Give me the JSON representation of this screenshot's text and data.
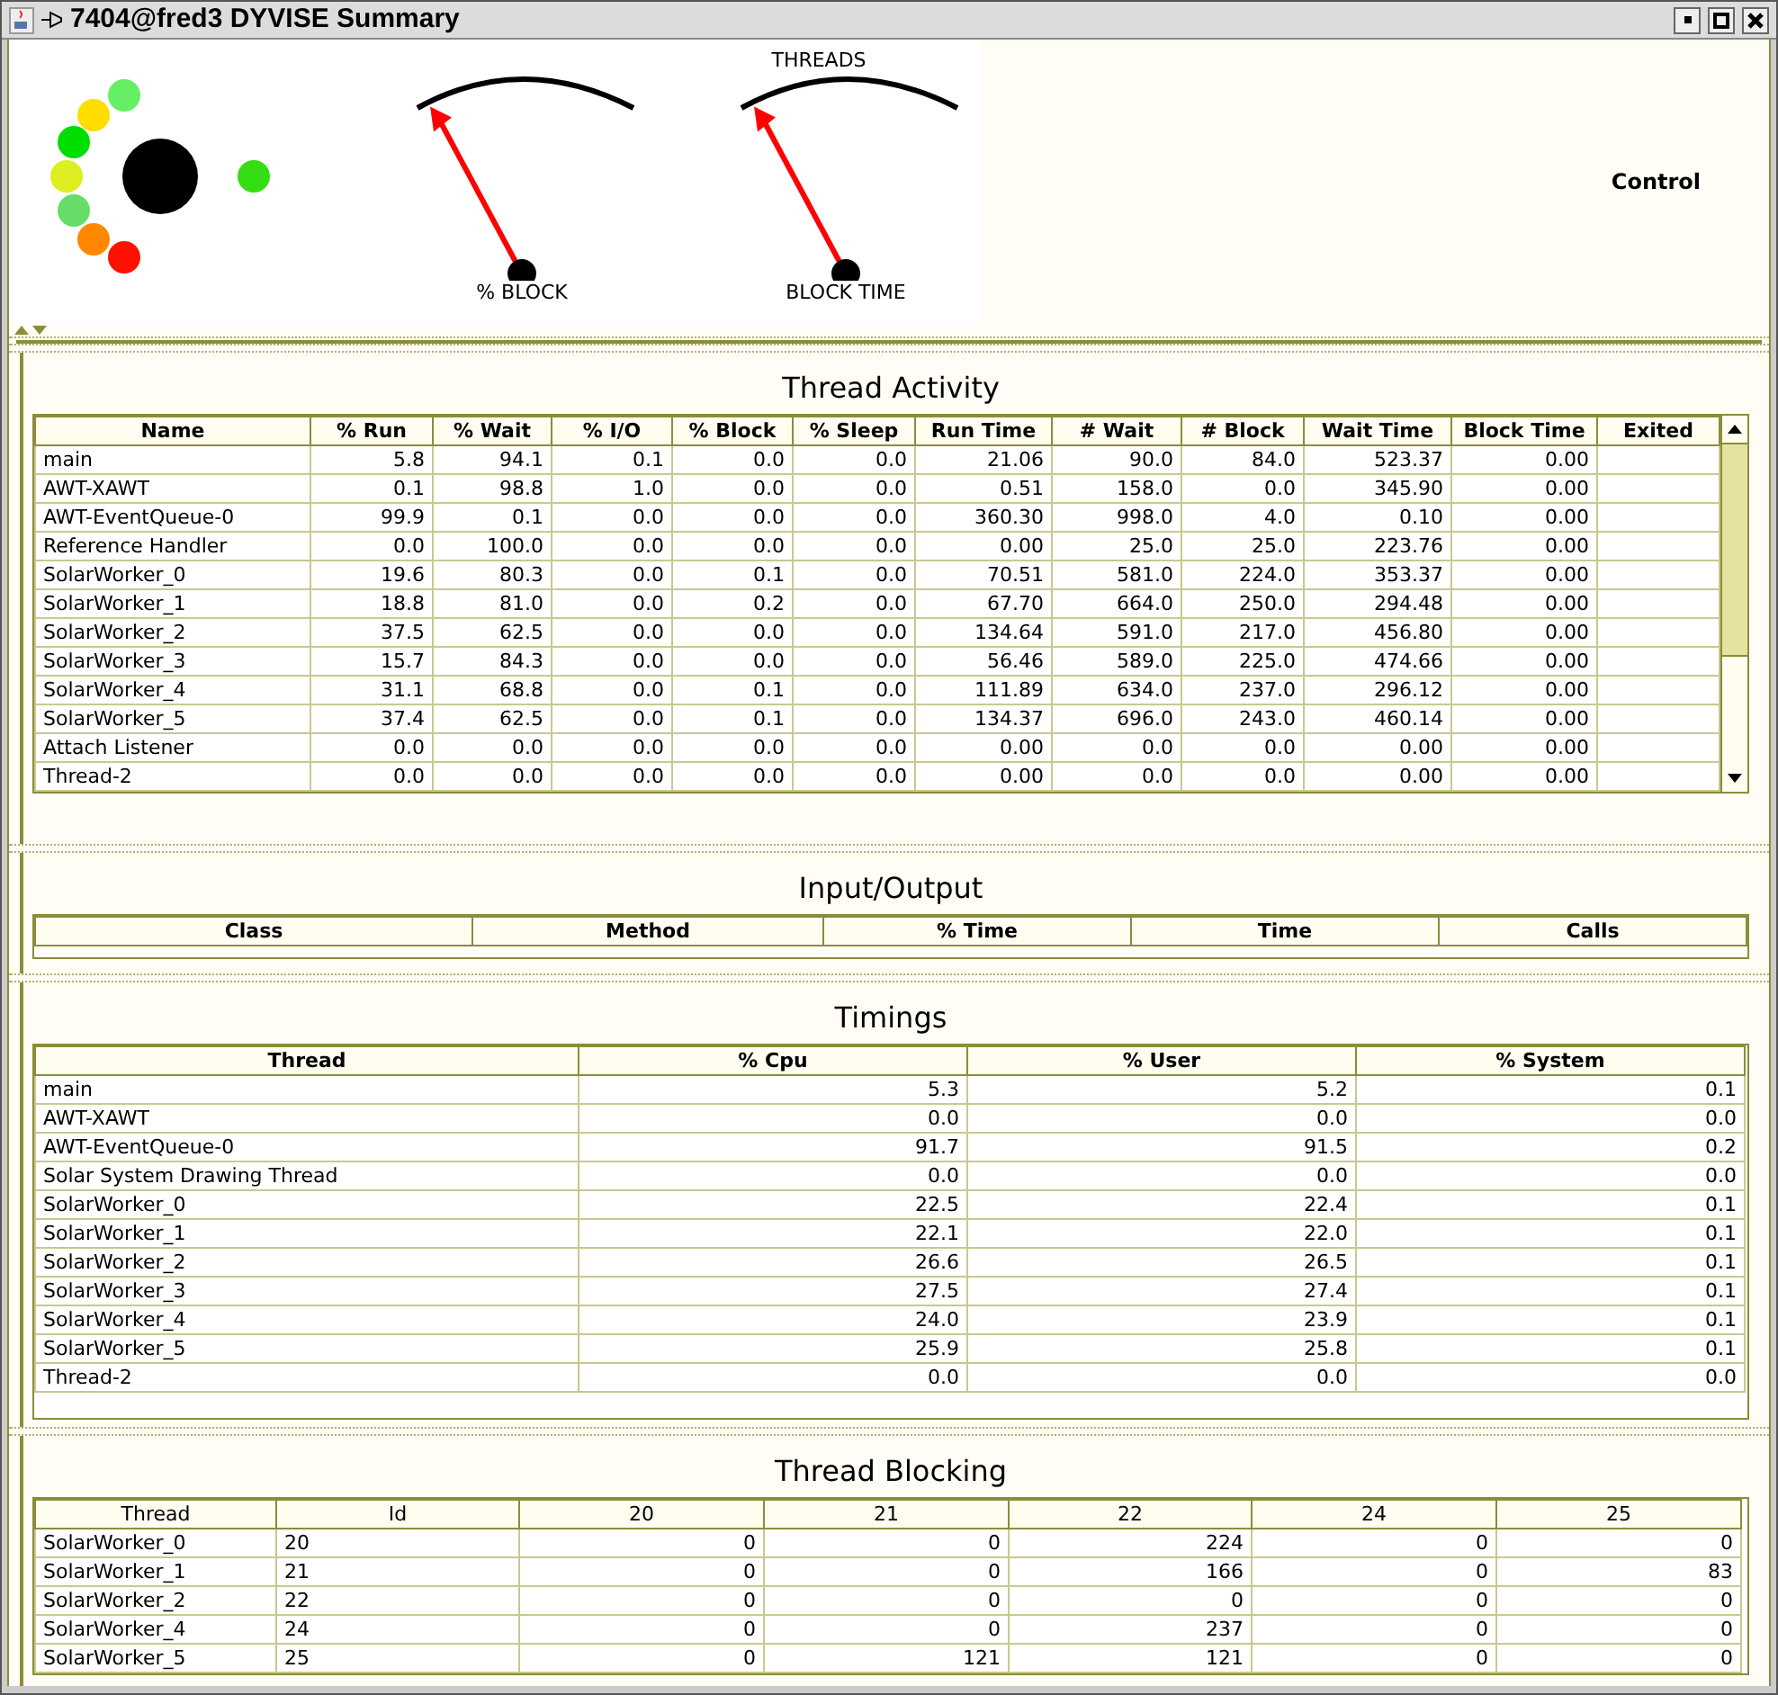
{
  "window": {
    "title": "7404@fred3 DYVISE Summary"
  },
  "top_panel": {
    "gauges_title": "THREADS",
    "gauges": [
      {
        "label": "% BLOCK"
      },
      {
        "label": "BLOCK TIME"
      }
    ],
    "control_label": "Control"
  },
  "thread_activity": {
    "title": "Thread Activity",
    "columns": [
      "Name",
      "% Run",
      "% Wait",
      "% I/O",
      "% Block",
      "% Sleep",
      "Run Time",
      "# Wait",
      "# Block",
      "Wait Time",
      "Block Time",
      "Exited"
    ],
    "rows": [
      [
        "main",
        "5.8",
        "94.1",
        "0.1",
        "0.0",
        "0.0",
        "21.06",
        "90.0",
        "84.0",
        "523.37",
        "0.00"
      ],
      [
        "AWT-XAWT",
        "0.1",
        "98.8",
        "1.0",
        "0.0",
        "0.0",
        "0.51",
        "158.0",
        "0.0",
        "345.90",
        "0.00"
      ],
      [
        "AWT-EventQueue-0",
        "99.9",
        "0.1",
        "0.0",
        "0.0",
        "0.0",
        "360.30",
        "998.0",
        "4.0",
        "0.10",
        "0.00"
      ],
      [
        "Reference Handler",
        "0.0",
        "100.0",
        "0.0",
        "0.0",
        "0.0",
        "0.00",
        "25.0",
        "25.0",
        "223.76",
        "0.00"
      ],
      [
        "SolarWorker_0",
        "19.6",
        "80.3",
        "0.0",
        "0.1",
        "0.0",
        "70.51",
        "581.0",
        "224.0",
        "353.37",
        "0.00"
      ],
      [
        "SolarWorker_1",
        "18.8",
        "81.0",
        "0.0",
        "0.2",
        "0.0",
        "67.70",
        "664.0",
        "250.0",
        "294.48",
        "0.00"
      ],
      [
        "SolarWorker_2",
        "37.5",
        "62.5",
        "0.0",
        "0.0",
        "0.0",
        "134.64",
        "591.0",
        "217.0",
        "456.80",
        "0.00"
      ],
      [
        "SolarWorker_3",
        "15.7",
        "84.3",
        "0.0",
        "0.0",
        "0.0",
        "56.46",
        "589.0",
        "225.0",
        "474.66",
        "0.00"
      ],
      [
        "SolarWorker_4",
        "31.1",
        "68.8",
        "0.0",
        "0.1",
        "0.0",
        "111.89",
        "634.0",
        "237.0",
        "296.12",
        "0.00"
      ],
      [
        "SolarWorker_5",
        "37.4",
        "62.5",
        "0.0",
        "0.1",
        "0.0",
        "134.37",
        "696.0",
        "243.0",
        "460.14",
        "0.00"
      ],
      [
        "Attach Listener",
        "0.0",
        "0.0",
        "0.0",
        "0.0",
        "0.0",
        "0.00",
        "0.0",
        "0.0",
        "0.00",
        "0.00"
      ],
      [
        "Thread-2",
        "0.0",
        "0.0",
        "0.0",
        "0.0",
        "0.0",
        "0.00",
        "0.0",
        "0.0",
        "0.00",
        "0.00"
      ]
    ]
  },
  "input_output": {
    "title": "Input/Output",
    "columns": [
      "Class",
      "Method",
      "% Time",
      "Time",
      "Calls"
    ]
  },
  "timings": {
    "title": "Timings",
    "columns": [
      "Thread",
      "% Cpu",
      "% User",
      "% System"
    ],
    "rows": [
      [
        "main",
        "5.3",
        "5.2",
        "0.1"
      ],
      [
        "AWT-XAWT",
        "0.0",
        "0.0",
        "0.0"
      ],
      [
        "AWT-EventQueue-0",
        "91.7",
        "91.5",
        "0.2"
      ],
      [
        "Solar System Drawing Thread",
        "0.0",
        "0.0",
        "0.0"
      ],
      [
        "SolarWorker_0",
        "22.5",
        "22.4",
        "0.1"
      ],
      [
        "SolarWorker_1",
        "22.1",
        "22.0",
        "0.1"
      ],
      [
        "SolarWorker_2",
        "26.6",
        "26.5",
        "0.1"
      ],
      [
        "SolarWorker_3",
        "27.5",
        "27.4",
        "0.1"
      ],
      [
        "SolarWorker_4",
        "24.0",
        "23.9",
        "0.1"
      ],
      [
        "SolarWorker_5",
        "25.9",
        "25.8",
        "0.1"
      ],
      [
        "Thread-2",
        "0.0",
        "0.0",
        "0.0"
      ]
    ]
  },
  "thread_blocking": {
    "title": "Thread Blocking",
    "columns": [
      "Thread",
      "Id",
      "20",
      "21",
      "22",
      "24",
      "25"
    ],
    "rows": [
      [
        "SolarWorker_0",
        "20",
        "0",
        "0",
        "224",
        "0",
        "0"
      ],
      [
        "SolarWorker_1",
        "21",
        "0",
        "0",
        "166",
        "0",
        "83"
      ],
      [
        "SolarWorker_2",
        "22",
        "0",
        "0",
        "0",
        "0",
        "0"
      ],
      [
        "SolarWorker_4",
        "24",
        "0",
        "0",
        "237",
        "0",
        "0"
      ],
      [
        "SolarWorker_5",
        "25",
        "0",
        "121",
        "121",
        "0",
        "0"
      ]
    ]
  }
}
